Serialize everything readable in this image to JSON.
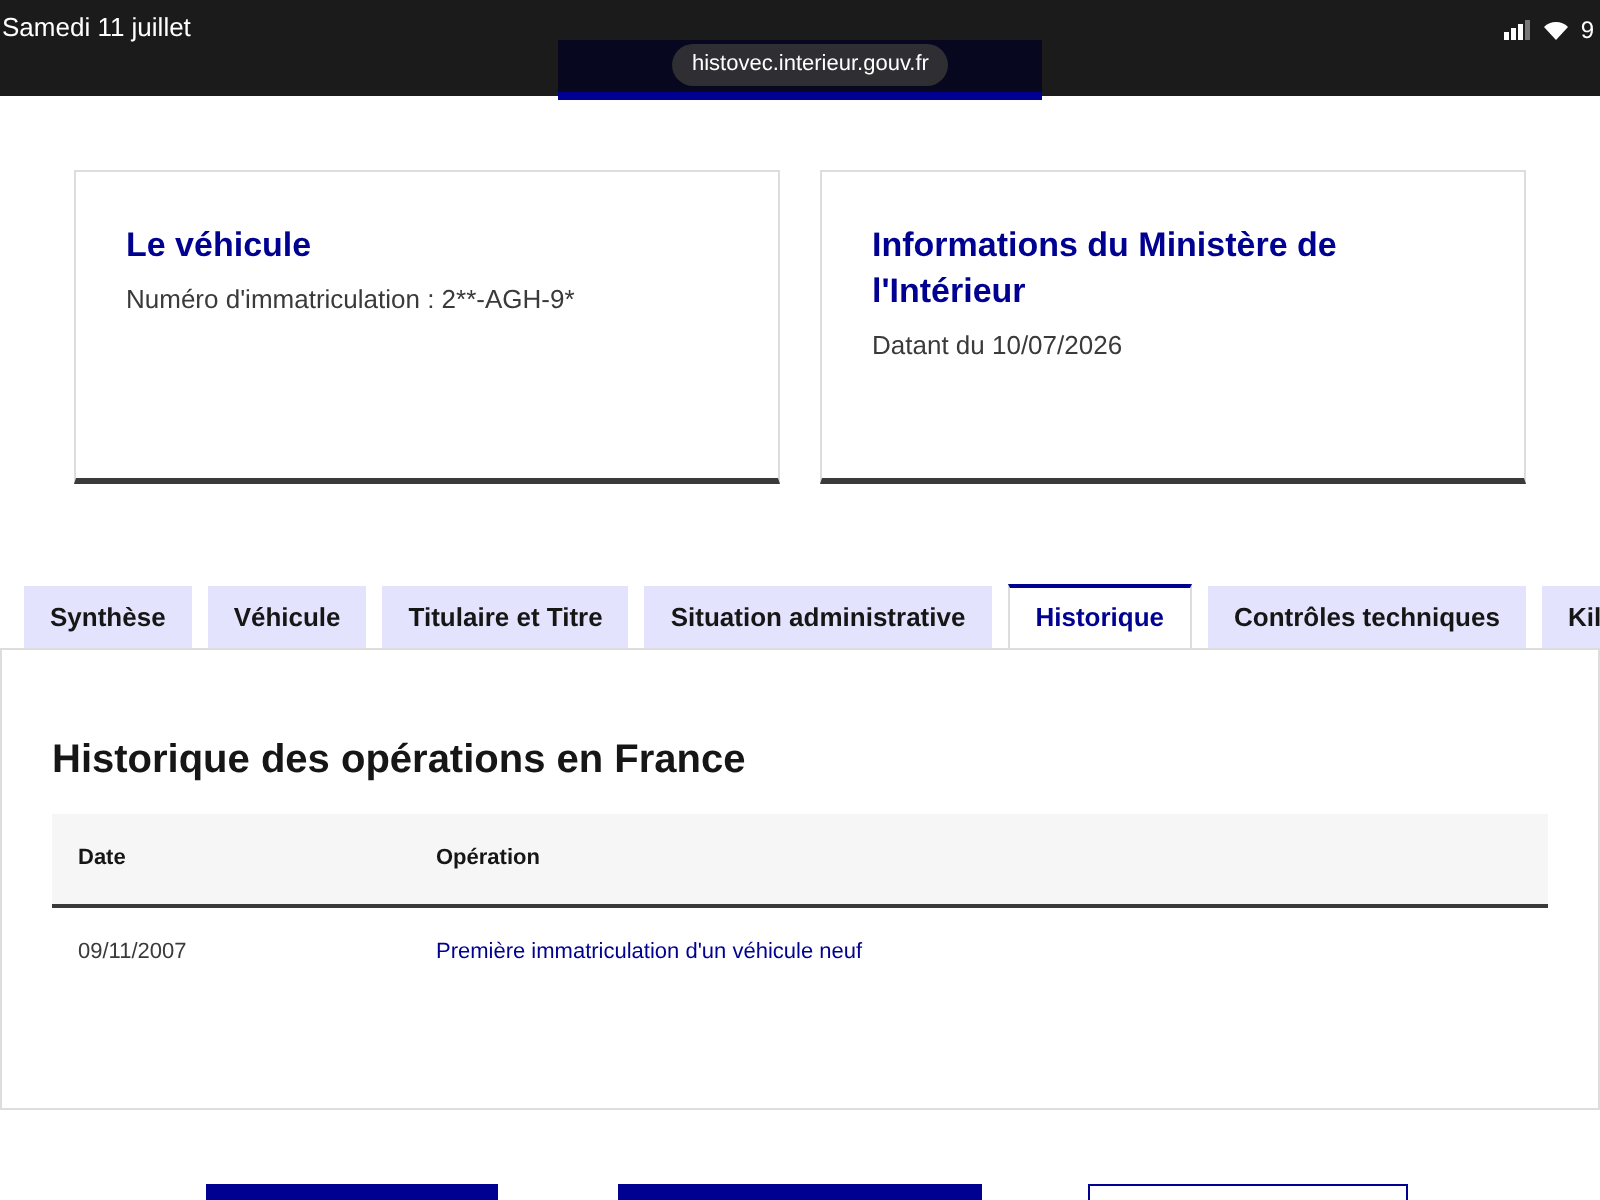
{
  "status_bar": {
    "date": "Samedi 11 juillet",
    "battery": "9"
  },
  "address_bar": {
    "url": "histovec.interieur.gouv.fr"
  },
  "cards": [
    {
      "title": "Le véhicule",
      "text": "Numéro d'immatriculation : 2**-AGH-9*"
    },
    {
      "title": "Informations du Ministère de l'Intérieur",
      "text": "Datant du 10/07/2026"
    }
  ],
  "tabs": [
    {
      "label": "Synthèse",
      "selected": false
    },
    {
      "label": "Véhicule",
      "selected": false
    },
    {
      "label": "Titulaire et Titre",
      "selected": false
    },
    {
      "label": "Situation administrative",
      "selected": false
    },
    {
      "label": "Historique",
      "selected": true
    },
    {
      "label": "Contrôles techniques",
      "selected": false
    },
    {
      "label": "Kil",
      "selected": false
    }
  ],
  "panel": {
    "title": "Historique des opérations en France",
    "table": {
      "columns": [
        "Date",
        "Opération"
      ],
      "rows": [
        [
          "09/11/2007",
          "Première immatriculation d'un véhicule neuf"
        ]
      ]
    }
  },
  "bottom_buttons": [
    {
      "kind": "primary"
    },
    {
      "kind": "primary"
    },
    {
      "kind": "secondary"
    }
  ]
}
